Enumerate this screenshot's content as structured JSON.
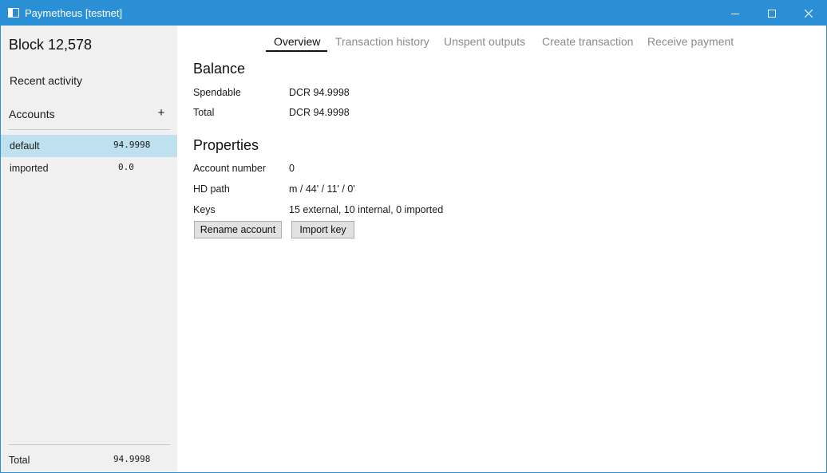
{
  "window": {
    "title": "Paymetheus [testnet]",
    "controls": {
      "minimize_icon": "minimize-icon",
      "maximize_icon": "maximize-icon",
      "close_icon": "close-icon"
    }
  },
  "sidebar": {
    "block_height": "Block 12,578",
    "recent_activity": "Recent activity",
    "accounts_label": "Accounts",
    "add_account": "+",
    "accounts": [
      {
        "name": "default",
        "balance": "94.9998",
        "selected": true
      },
      {
        "name": "imported",
        "balance": "0.0",
        "selected": false
      }
    ],
    "total_label": "Total",
    "total_value": "94.9998"
  },
  "tabs": [
    {
      "label": "Overview",
      "active": true
    },
    {
      "label": "Transaction history",
      "active": false
    },
    {
      "label": "Unspent outputs",
      "active": false
    },
    {
      "label": "Create transaction",
      "active": false
    },
    {
      "label": "Receive payment",
      "active": false
    }
  ],
  "balance": {
    "title": "Balance",
    "spendable_label": "Spendable",
    "spendable_value": "DCR 94.9998",
    "total_label": "Total",
    "total_value": "DCR 94.9998"
  },
  "properties": {
    "title": "Properties",
    "account_number_label": "Account number",
    "account_number_value": "0",
    "hd_path_label": "HD path",
    "hd_path_value": "m / 44' / 11' / 0'",
    "keys_label": "Keys",
    "keys_value": "15 external, 10 internal, 0 imported"
  },
  "actions": {
    "rename_account": "Rename account",
    "import_key": "Import key"
  },
  "colors": {
    "titlebar": "#2b8fd6",
    "sidebar_bg": "#f0f0f0",
    "selected_row": "#bee0ef"
  }
}
